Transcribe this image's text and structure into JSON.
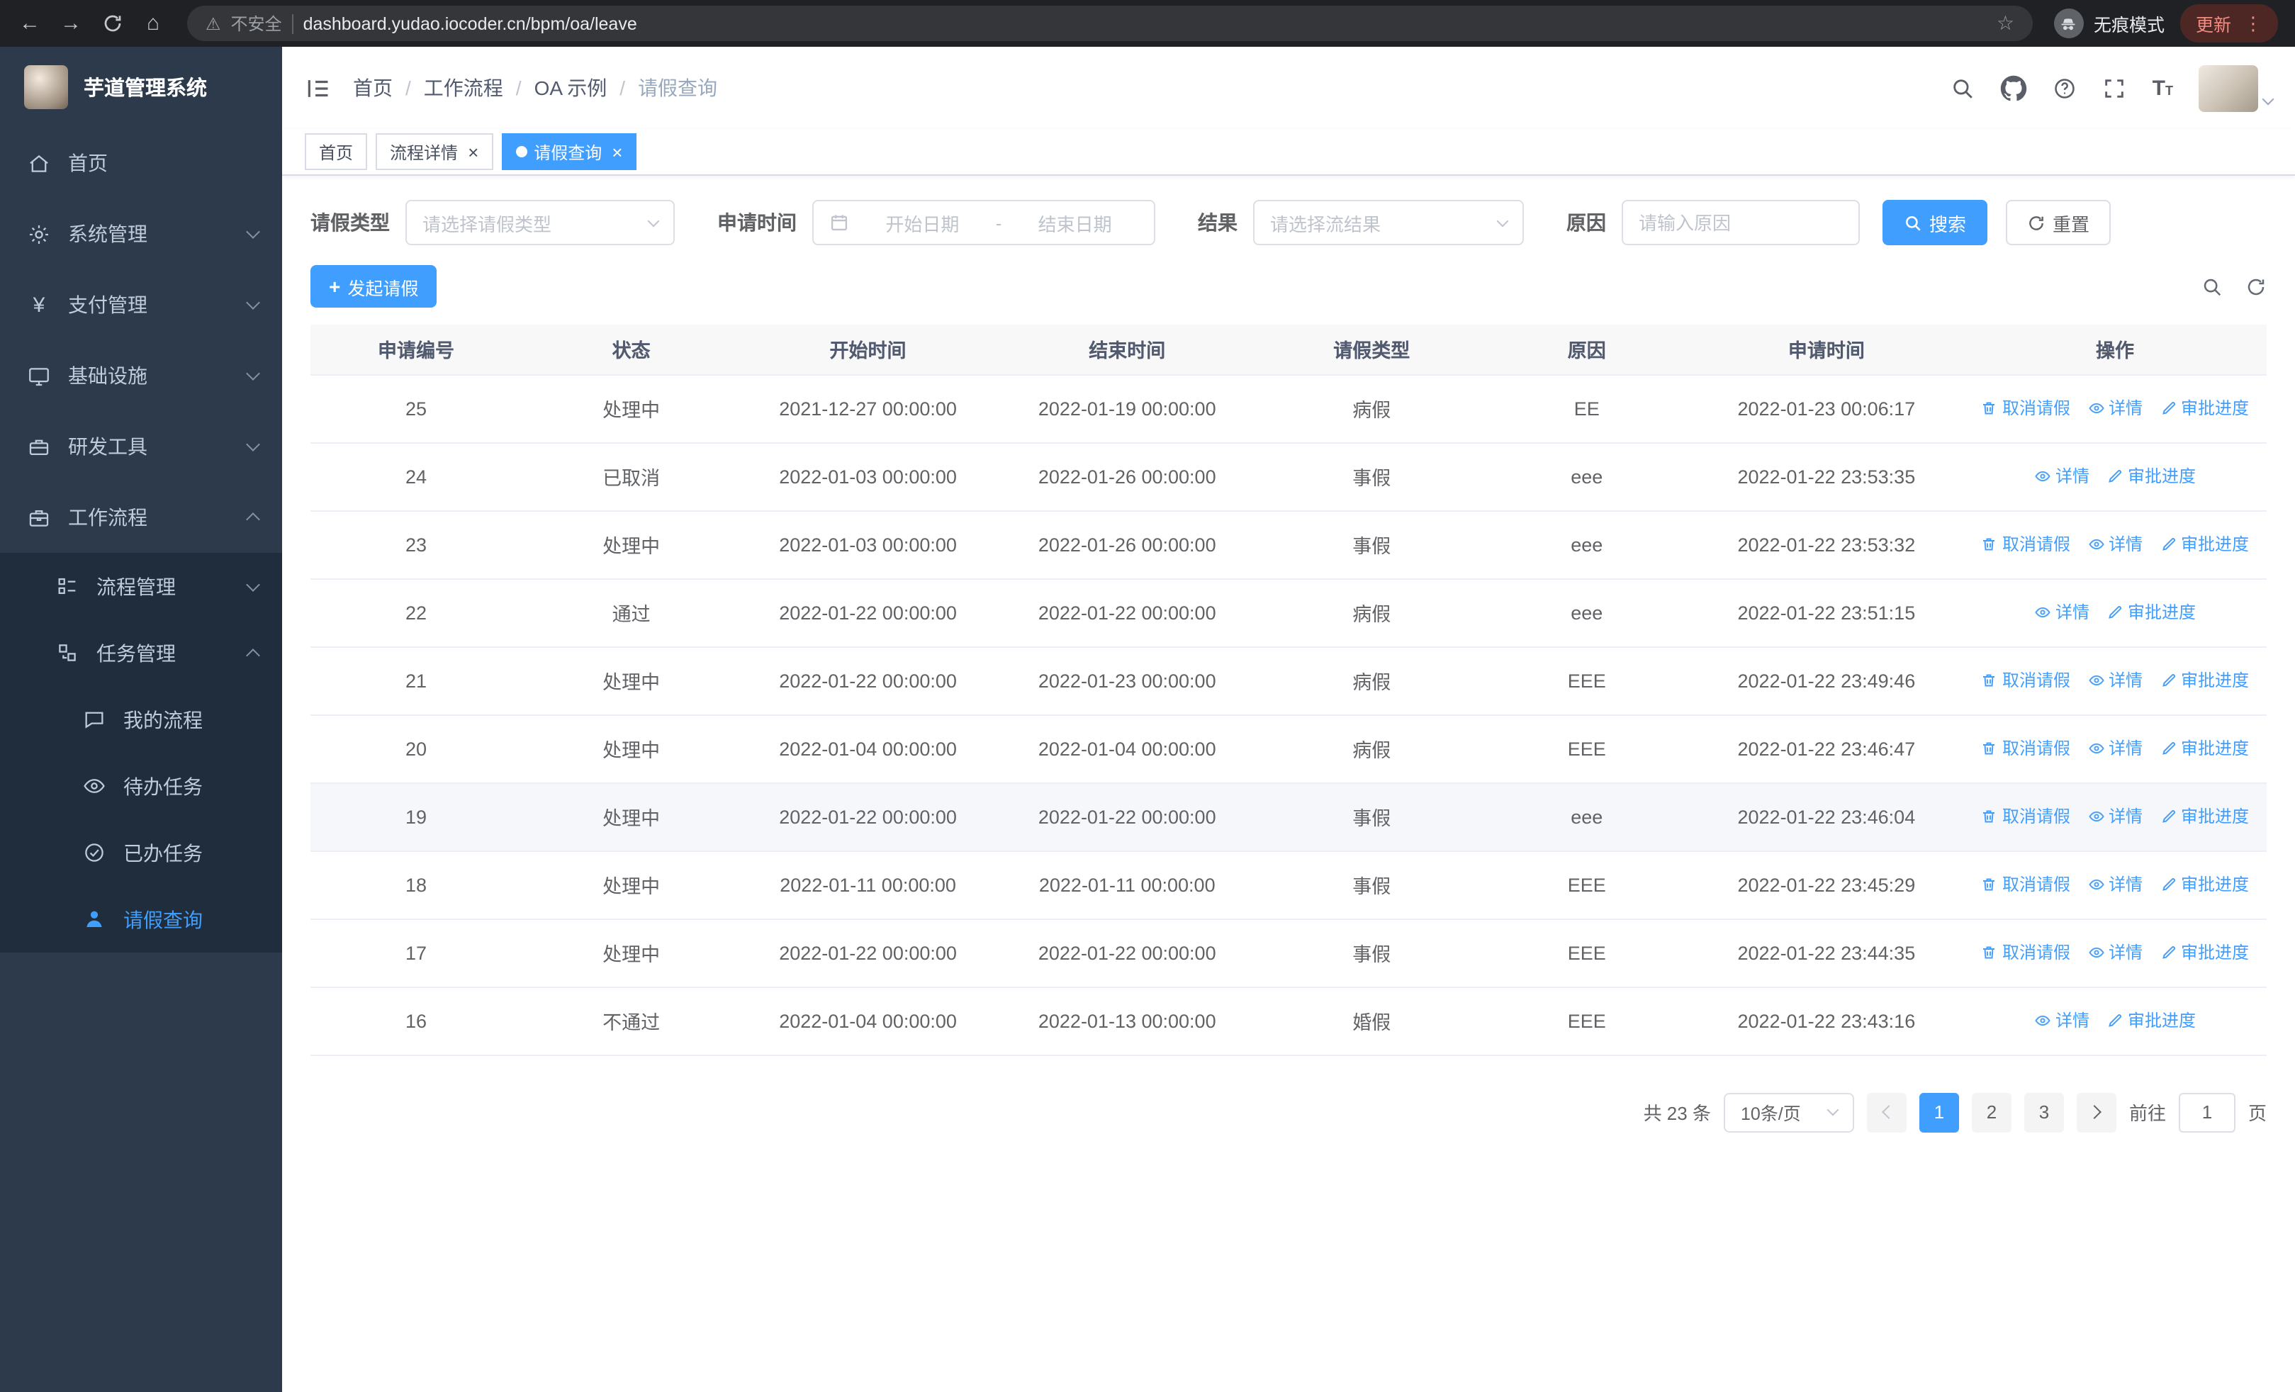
{
  "colors": {
    "primary": "#409eff",
    "sidebar_bg": "#2d3a4b",
    "sidebar_sub_bg": "#1f2d3d",
    "browser_bg": "#202124"
  },
  "browser": {
    "security_label": "不安全",
    "url": "dashboard.yudao.iocoder.cn/bpm/oa/leave",
    "incognito_label": "无痕模式",
    "update_label": "更新"
  },
  "sidebar": {
    "logo_title": "芋道管理系统",
    "items": [
      {
        "label": "首页",
        "icon": "home-icon"
      },
      {
        "label": "系统管理",
        "icon": "gear-icon"
      },
      {
        "label": "支付管理",
        "icon": "yen-icon"
      },
      {
        "label": "基础设施",
        "icon": "monitor-icon"
      },
      {
        "label": "研发工具",
        "icon": "toolbox-icon"
      },
      {
        "label": "工作流程",
        "icon": "briefcase-icon"
      }
    ],
    "level2": [
      {
        "label": "流程管理",
        "icon": "flow-icon"
      },
      {
        "label": "任务管理",
        "icon": "tasks-icon"
      }
    ],
    "level3": [
      {
        "label": "我的流程",
        "icon": "chat-icon"
      },
      {
        "label": "待办任务",
        "icon": "eye-icon"
      },
      {
        "label": "已办任务",
        "icon": "done-icon"
      },
      {
        "label": "请假查询",
        "icon": "user-icon",
        "active": true
      }
    ]
  },
  "header": {
    "breadcrumb": [
      "首页",
      "工作流程",
      "OA 示例",
      "请假查询"
    ]
  },
  "tabs": [
    {
      "label": "首页",
      "closable": false,
      "active": false
    },
    {
      "label": "流程详情",
      "closable": true,
      "active": false
    },
    {
      "label": "请假查询",
      "closable": true,
      "active": true
    }
  ],
  "filters": {
    "leave_type": {
      "label": "请假类型",
      "placeholder": "请选择请假类型"
    },
    "apply_time": {
      "label": "申请时间",
      "start_placeholder": "开始日期",
      "separator": "-",
      "end_placeholder": "结束日期"
    },
    "result": {
      "label": "结果",
      "placeholder": "请选择流结果"
    },
    "reason": {
      "label": "原因",
      "placeholder": "请输入原因"
    },
    "search_label": "搜索",
    "reset_label": "重置"
  },
  "toolbar": {
    "create_label": "发起请假"
  },
  "table": {
    "headers": [
      "申请编号",
      "状态",
      "开始时间",
      "结束时间",
      "请假类型",
      "原因",
      "申请时间",
      "操作"
    ],
    "rows": [
      {
        "id": "25",
        "status": "处理中",
        "start": "2021-12-27 00:00:00",
        "end": "2022-01-19 00:00:00",
        "type": "病假",
        "reason": "EE",
        "apply_time": "2022-01-23 00:06:17",
        "highlighted": false,
        "actions": [
          {
            "label": "取消请假",
            "icon": "trash-icon"
          },
          {
            "label": "详情",
            "icon": "eye-icon"
          },
          {
            "label": "审批进度",
            "icon": "pen-icon"
          }
        ]
      },
      {
        "id": "24",
        "status": "已取消",
        "start": "2022-01-03 00:00:00",
        "end": "2022-01-26 00:00:00",
        "type": "事假",
        "reason": "eee",
        "apply_time": "2022-01-22 23:53:35",
        "highlighted": false,
        "actions": [
          {
            "label": "详情",
            "icon": "eye-icon"
          },
          {
            "label": "审批进度",
            "icon": "pen-icon"
          }
        ]
      },
      {
        "id": "23",
        "status": "处理中",
        "start": "2022-01-03 00:00:00",
        "end": "2022-01-26 00:00:00",
        "type": "事假",
        "reason": "eee",
        "apply_time": "2022-01-22 23:53:32",
        "highlighted": false,
        "actions": [
          {
            "label": "取消请假",
            "icon": "trash-icon"
          },
          {
            "label": "详情",
            "icon": "eye-icon"
          },
          {
            "label": "审批进度",
            "icon": "pen-icon"
          }
        ]
      },
      {
        "id": "22",
        "status": "通过",
        "start": "2022-01-22 00:00:00",
        "end": "2022-01-22 00:00:00",
        "type": "病假",
        "reason": "eee",
        "apply_time": "2022-01-22 23:51:15",
        "highlighted": false,
        "actions": [
          {
            "label": "详情",
            "icon": "eye-icon"
          },
          {
            "label": "审批进度",
            "icon": "pen-icon"
          }
        ]
      },
      {
        "id": "21",
        "status": "处理中",
        "start": "2022-01-22 00:00:00",
        "end": "2022-01-23 00:00:00",
        "type": "病假",
        "reason": "EEE",
        "apply_time": "2022-01-22 23:49:46",
        "highlighted": false,
        "actions": [
          {
            "label": "取消请假",
            "icon": "trash-icon"
          },
          {
            "label": "详情",
            "icon": "eye-icon"
          },
          {
            "label": "审批进度",
            "icon": "pen-icon"
          }
        ]
      },
      {
        "id": "20",
        "status": "处理中",
        "start": "2022-01-04 00:00:00",
        "end": "2022-01-04 00:00:00",
        "type": "病假",
        "reason": "EEE",
        "apply_time": "2022-01-22 23:46:47",
        "highlighted": false,
        "actions": [
          {
            "label": "取消请假",
            "icon": "trash-icon"
          },
          {
            "label": "详情",
            "icon": "eye-icon"
          },
          {
            "label": "审批进度",
            "icon": "pen-icon"
          }
        ]
      },
      {
        "id": "19",
        "status": "处理中",
        "start": "2022-01-22 00:00:00",
        "end": "2022-01-22 00:00:00",
        "type": "事假",
        "reason": "eee",
        "apply_time": "2022-01-22 23:46:04",
        "highlighted": true,
        "actions": [
          {
            "label": "取消请假",
            "icon": "trash-icon"
          },
          {
            "label": "详情",
            "icon": "eye-icon"
          },
          {
            "label": "审批进度",
            "icon": "pen-icon"
          }
        ]
      },
      {
        "id": "18",
        "status": "处理中",
        "start": "2022-01-11 00:00:00",
        "end": "2022-01-11 00:00:00",
        "type": "事假",
        "reason": "EEE",
        "apply_time": "2022-01-22 23:45:29",
        "highlighted": false,
        "actions": [
          {
            "label": "取消请假",
            "icon": "trash-icon"
          },
          {
            "label": "详情",
            "icon": "eye-icon"
          },
          {
            "label": "审批进度",
            "icon": "pen-icon"
          }
        ]
      },
      {
        "id": "17",
        "status": "处理中",
        "start": "2022-01-22 00:00:00",
        "end": "2022-01-22 00:00:00",
        "type": "事假",
        "reason": "EEE",
        "apply_time": "2022-01-22 23:44:35",
        "highlighted": false,
        "actions": [
          {
            "label": "取消请假",
            "icon": "trash-icon"
          },
          {
            "label": "详情",
            "icon": "eye-icon"
          },
          {
            "label": "审批进度",
            "icon": "pen-icon"
          }
        ]
      },
      {
        "id": "16",
        "status": "不通过",
        "start": "2022-01-04 00:00:00",
        "end": "2022-01-13 00:00:00",
        "type": "婚假",
        "reason": "EEE",
        "apply_time": "2022-01-22 23:43:16",
        "highlighted": false,
        "actions": [
          {
            "label": "详情",
            "icon": "eye-icon"
          },
          {
            "label": "审批进度",
            "icon": "pen-icon"
          }
        ]
      }
    ]
  },
  "pagination": {
    "total_label": "共 23 条",
    "page_size_value": "10条/页",
    "pages": [
      "1",
      "2",
      "3"
    ],
    "active_page": "1",
    "goto_label": "前往",
    "goto_value": "1",
    "goto_suffix": "页"
  }
}
